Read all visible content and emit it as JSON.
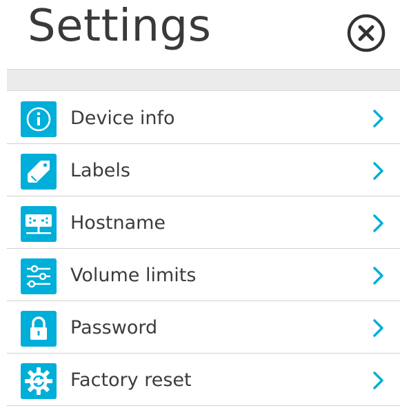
{
  "header": {
    "title": "Settings",
    "close_icon": "close-circle-icon"
  },
  "colors": {
    "accent": "#00aeda",
    "title_text": "#3a3a3a",
    "label_text": "#3c3c3c",
    "band": "#ebebeb",
    "divider": "#d0d0d0"
  },
  "menu": {
    "items": [
      {
        "label": "Device info",
        "icon": "info-icon"
      },
      {
        "label": "Labels",
        "icon": "tag-icon"
      },
      {
        "label": "Hostname",
        "icon": "network-device-icon"
      },
      {
        "label": "Volume limits",
        "icon": "sliders-icon"
      },
      {
        "label": "Password",
        "icon": "lock-icon"
      },
      {
        "label": "Factory reset",
        "icon": "gear-reset-icon"
      }
    ],
    "chevron_icon": "chevron-right-icon"
  }
}
